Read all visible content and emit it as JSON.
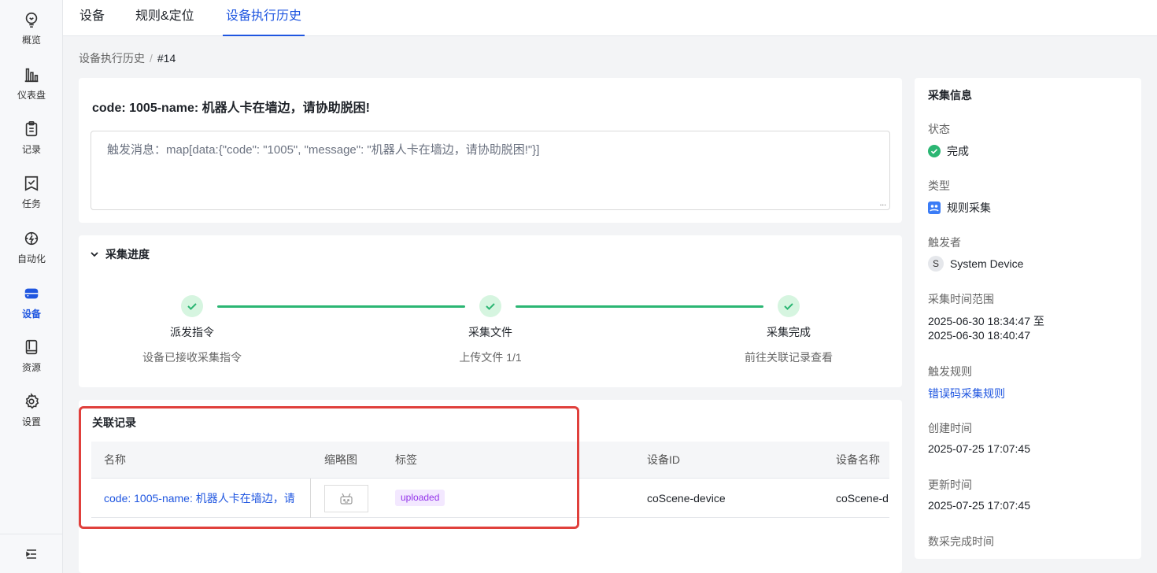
{
  "sidebar": {
    "items": [
      {
        "label": "概览",
        "icon": "lightbulb-icon"
      },
      {
        "label": "仪表盘",
        "icon": "bar-chart-icon"
      },
      {
        "label": "记录",
        "icon": "clipboard-icon"
      },
      {
        "label": "任务",
        "icon": "task-icon"
      },
      {
        "label": "自动化",
        "icon": "automation-icon"
      },
      {
        "label": "设备",
        "icon": "device-icon",
        "active": true
      },
      {
        "label": "资源",
        "icon": "book-icon"
      },
      {
        "label": "设置",
        "icon": "gear-icon"
      }
    ],
    "collapse_icon": "expand-sidebar-icon"
  },
  "tabs": [
    {
      "label": "设备"
    },
    {
      "label": "规则&定位"
    },
    {
      "label": "设备执行历史",
      "active": true
    }
  ],
  "breadcrumb": {
    "parent": "设备执行历史",
    "separator": "/",
    "current": "#14"
  },
  "message": {
    "title": "code: 1005-name: 机器人卡在墙边，请协助脱困!",
    "content": "触发消息：map[data:{\"code\": \"1005\", \"message\": \"机器人卡在墙边，请协助脱困!\"}]",
    "resize_glyph": "..."
  },
  "progress": {
    "title": "采集进度",
    "steps": [
      {
        "title": "派发指令",
        "desc": "设备已接收采集指令",
        "status": "done"
      },
      {
        "title": "采集文件",
        "desc": "上传文件 1/1",
        "status": "done"
      },
      {
        "title": "采集完成",
        "desc": "前往关联记录查看",
        "status": "done"
      }
    ]
  },
  "related": {
    "title": "关联记录",
    "columns": [
      "名称",
      "缩略图",
      "标签",
      "设备ID",
      "设备名称"
    ],
    "rows": [
      {
        "name": "code: 1005-name: 机器人卡在墙边，请",
        "thumbnail_icon": "robot-icon",
        "tag": "uploaded",
        "device_id": "coScene-device",
        "device_name": "coScene-d"
      }
    ]
  },
  "info": {
    "title": "采集信息",
    "status_label": "状态",
    "status_value": "完成",
    "type_label": "类型",
    "type_value": "规则采集",
    "trigger_label": "触发者",
    "trigger_avatar": "S",
    "trigger_value": "System Device",
    "range_label": "采集时间范围",
    "range_start": "2025-06-30 18:34:47 至",
    "range_end": "2025-06-30 18:40:47",
    "rule_label": "触发规则",
    "rule_value": "错误码采集规则",
    "created_label": "创建时间",
    "created_value": "2025-07-25 17:07:45",
    "updated_label": "更新时间",
    "updated_value": "2025-07-25 17:07:45",
    "finish_label": "数采完成时间"
  },
  "colors": {
    "accent": "#1f56e0",
    "success": "#2bb673",
    "tag_bg": "#f3e8ff",
    "tag_text": "#9333ea",
    "highlight": "#e0403c"
  }
}
